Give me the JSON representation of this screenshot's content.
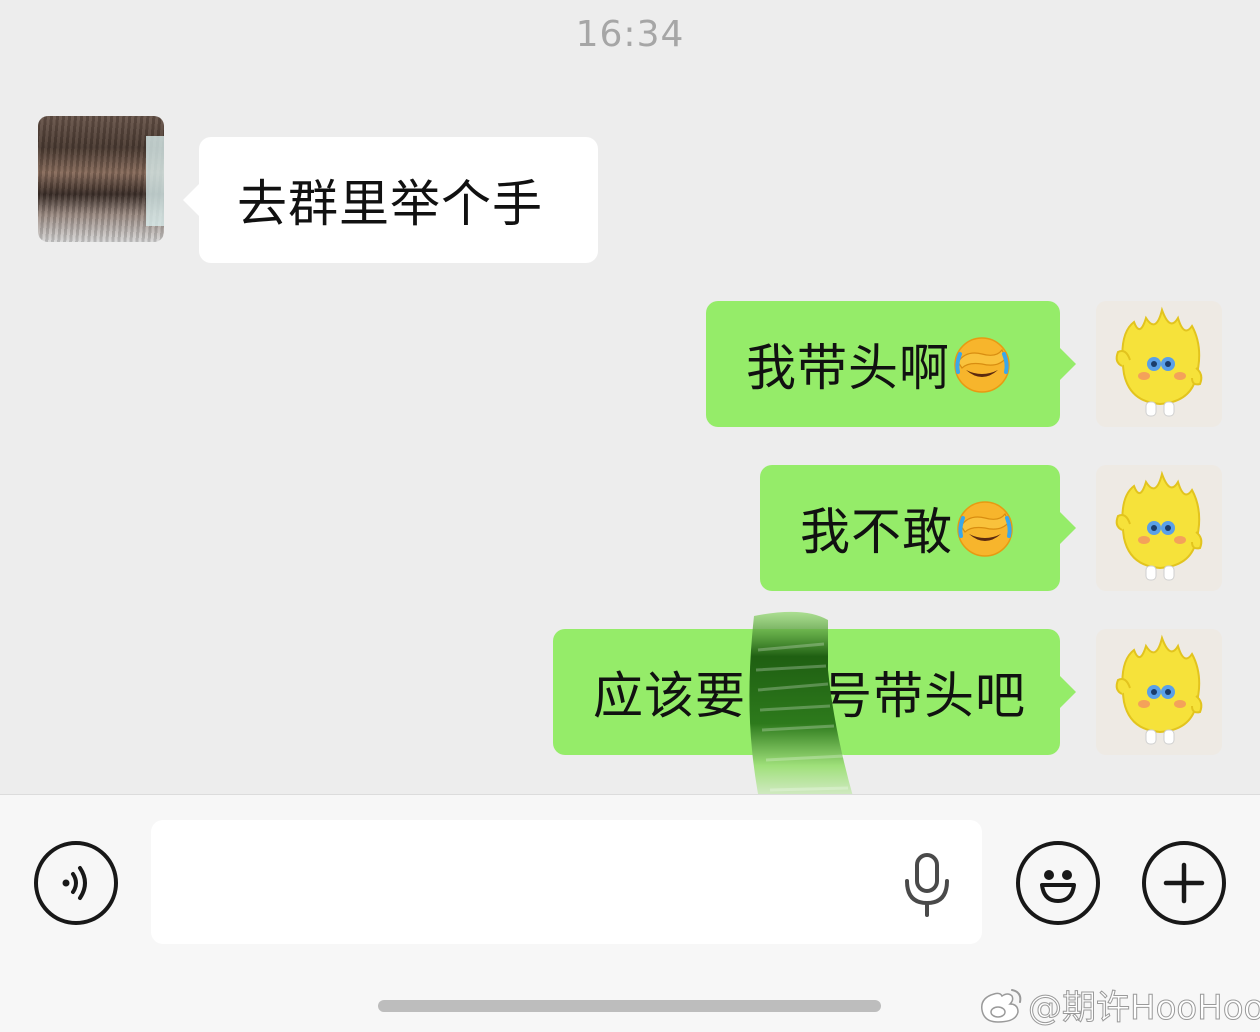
{
  "status": {
    "timestamp": "16:34"
  },
  "messages": [
    {
      "sender": "peer",
      "text": "去群里举个手",
      "emoji": ""
    },
    {
      "sender": "self",
      "text": "我带头啊",
      "emoji": "facepalm-crying-emoji"
    },
    {
      "sender": "self",
      "text": "我不敢",
      "emoji": "facepalm-crying-emoji"
    },
    {
      "sender": "self",
      "text": "应该要",
      "text_after_redaction": "号带头吧",
      "emoji": ""
    }
  ],
  "input_bar": {
    "text_value": "",
    "icons": [
      "voice-mode-icon",
      "microphone-icon",
      "emoji-face-icon",
      "plus-icon"
    ]
  },
  "watermark": {
    "logo": "weibo-logo-icon",
    "text": "@期许HooHoo"
  },
  "colors": {
    "chat_background": "#ededed",
    "outgoing_bubble": "#95ec69",
    "incoming_bubble": "#ffffff",
    "input_bar_background": "#f7f7f7"
  }
}
